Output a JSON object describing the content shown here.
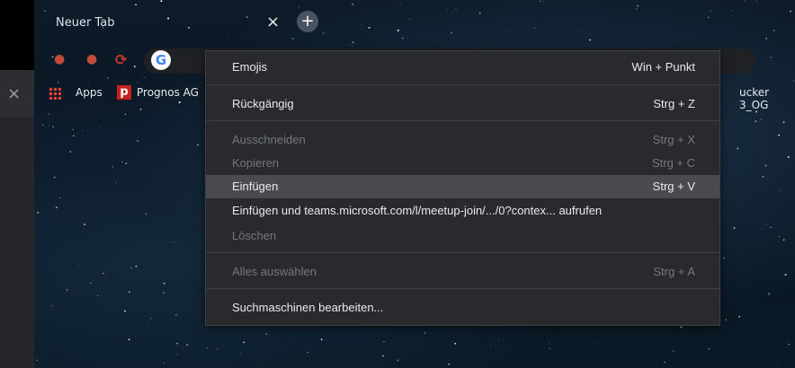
{
  "tabbar": {
    "tab_title": "Neuer Tab",
    "close_glyph": "×",
    "new_tab_glyph": "+"
  },
  "toolbar": {
    "google_logo": "G"
  },
  "bookmarks": {
    "items": [
      {
        "label": "Apps",
        "icon": "apps-grid-icon"
      },
      {
        "label": "Prognos AG",
        "icon": "prognos-icon"
      },
      {
        "label": "ucker 3_OG",
        "icon": "bookmark-icon"
      }
    ],
    "prognos_logo": "p"
  },
  "context_menu": {
    "items": [
      {
        "label": "Emojis",
        "shortcut": "Win + Punkt",
        "enabled": true
      },
      {
        "label": "Rückgängig",
        "shortcut": "Strg + Z",
        "enabled": true
      },
      {
        "label": "Ausschneiden",
        "shortcut": "Strg + X",
        "enabled": false
      },
      {
        "label": "Kopieren",
        "shortcut": "Strg + C",
        "enabled": false
      },
      {
        "label": "Einfügen",
        "shortcut": "Strg + V",
        "enabled": true,
        "highlighted": true
      },
      {
        "label": "Einfügen und teams.microsoft.com/l/meetup-join/.../0?contex... aufrufen",
        "shortcut": "",
        "enabled": true
      },
      {
        "label": "Löschen",
        "shortcut": "",
        "enabled": false
      },
      {
        "label": "Alles auswählen",
        "shortcut": "Strg + A",
        "enabled": false
      },
      {
        "label": "Suchmaschinen bearbeiten...",
        "shortcut": "",
        "enabled": true
      }
    ]
  },
  "side": {
    "close_glyph": "×"
  },
  "colors": {
    "menu_bg": "#292a2d",
    "highlight": "#4a4b4f",
    "disabled_text": "#75787d"
  }
}
